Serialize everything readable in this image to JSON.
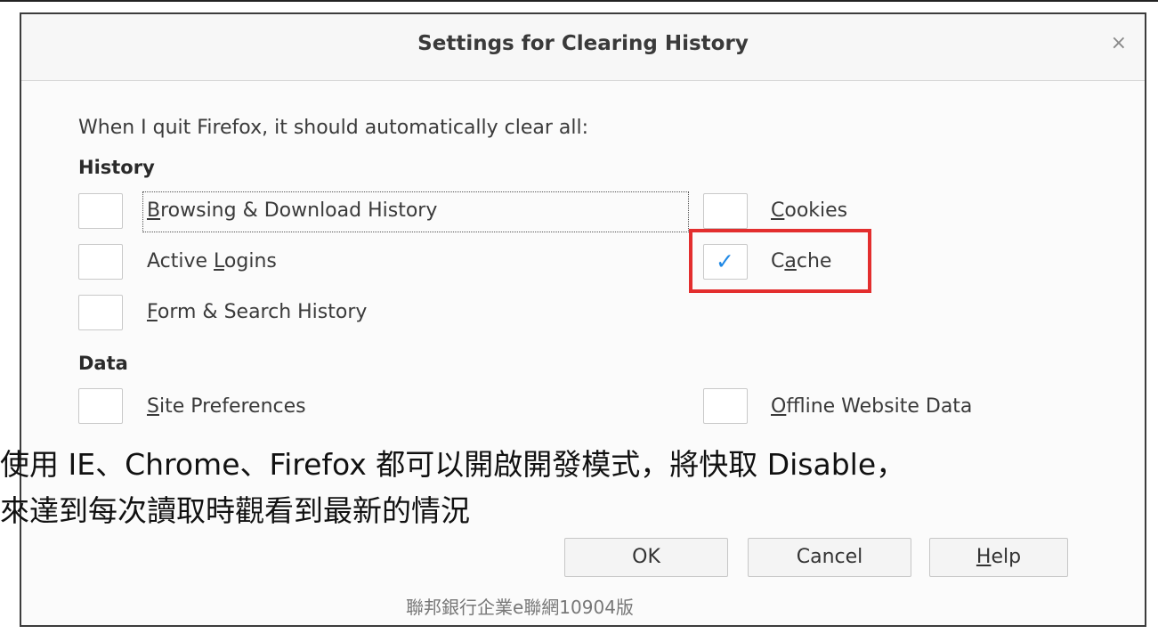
{
  "dialog": {
    "title": "Settings for Clearing History",
    "close_symbol": "×",
    "intro": "When I quit Firefox, it should automatically clear all:"
  },
  "sections": {
    "history": "History",
    "data": "Data"
  },
  "options": {
    "browsing_history": {
      "pre": "",
      "accel": "B",
      "post": "rowsing & Download History",
      "checked": false
    },
    "cookies": {
      "pre": "",
      "accel": "C",
      "post": "ookies",
      "checked": false
    },
    "active_logins": {
      "pre": "Active ",
      "accel": "L",
      "post": "ogins",
      "checked": false
    },
    "cache": {
      "pre": "C",
      "accel": "a",
      "post": "che",
      "checked": true
    },
    "form_history": {
      "pre": "",
      "accel": "F",
      "post": "orm & Search History",
      "checked": false
    },
    "site_prefs": {
      "pre": "",
      "accel": "S",
      "post": "ite Preferences",
      "checked": false
    },
    "offline_data": {
      "pre": "",
      "accel": "O",
      "post": "ffline Website Data",
      "checked": false
    }
  },
  "check_glyph": "✓",
  "caption": {
    "line1": "使用 IE、Chrome、Firefox 都可以開啟開發模式，將快取 Disable，",
    "line2": "來達到每次讀取時觀看到最新的情況"
  },
  "buttons": {
    "ok": "OK",
    "cancel": "Cancel",
    "help_accel": "H",
    "help_rest": "elp"
  },
  "footer": "聯邦銀行企業e聯網10904版",
  "colors": {
    "accent_check": "#1e88e5",
    "highlight_red": "#e32e2e"
  }
}
